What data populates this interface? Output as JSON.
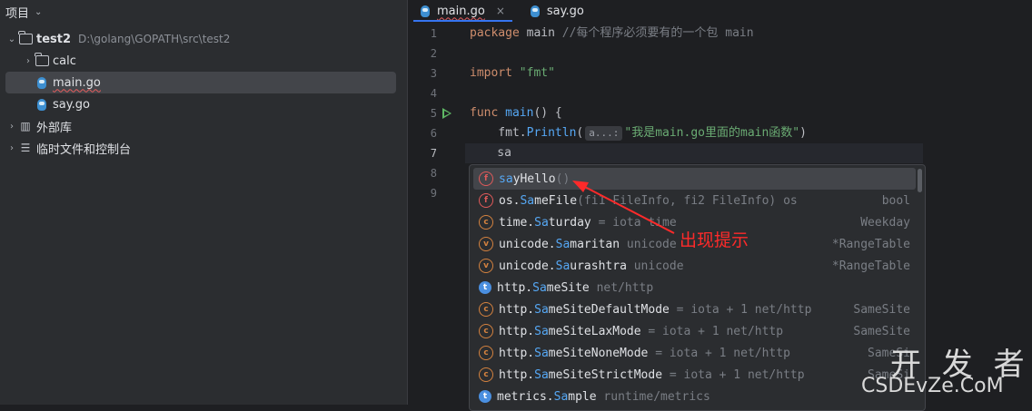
{
  "project": {
    "title": "项目",
    "items": [
      {
        "label": "test2",
        "path": "D:\\golang\\GOPATH\\src\\test2"
      },
      {
        "label": "calc"
      },
      {
        "label": "main.go"
      },
      {
        "label": "say.go"
      },
      {
        "label": "外部库"
      },
      {
        "label": "临时文件和控制台"
      }
    ]
  },
  "tabs": [
    {
      "label": "main.go",
      "close": "×"
    },
    {
      "label": "say.go"
    }
  ],
  "gutter": {
    "lines": [
      "1",
      "2",
      "3",
      "4",
      "5",
      "6",
      "7",
      "8",
      "9"
    ]
  },
  "code": {
    "l1_kw": "package",
    "l1_name": " main ",
    "l1_comment": "//每个程序必须要有的一个包 main",
    "l3_kw": "import",
    "l3_str": " \"fmt\"",
    "l5_kw": "func",
    "l5_fn": " main",
    "l5_rest": "() {",
    "l6_pkg": "    fmt.",
    "l6_fn": "Println",
    "l6_open": "(",
    "l6_hint": "a...:",
    "l6_str": "\"我是main.go里面的main函数\"",
    "l6_close": ")",
    "l7_text": "    sa"
  },
  "completion": {
    "items": [
      {
        "kind": "f",
        "match": "sa",
        "name": "yHello",
        "tail": "()",
        "type": ""
      },
      {
        "kind": "f",
        "prefix": "os.",
        "match": "Sa",
        "name": "meFile",
        "tail": "(fi1 FileInfo, fi2 FileInfo) os",
        "type": "bool"
      },
      {
        "kind": "c",
        "prefix": "time.",
        "match": "Sa",
        "name": "turday",
        "tail": " = iota time",
        "type": "Weekday"
      },
      {
        "kind": "v",
        "prefix": "unicode.",
        "match": "Sa",
        "name": "maritan",
        "tail": " unicode",
        "type": "*RangeTable"
      },
      {
        "kind": "v",
        "prefix": "unicode.",
        "match": "Sa",
        "name": "urashtra",
        "tail": " unicode",
        "type": "*RangeTable"
      },
      {
        "kind": "t",
        "prefix": "http.",
        "match": "Sa",
        "name": "meSite",
        "tail": " net/http",
        "type": ""
      },
      {
        "kind": "c",
        "prefix": "http.",
        "match": "Sa",
        "name": "meSiteDefaultMode",
        "tail": " = iota + 1 net/http",
        "type": "SameSite"
      },
      {
        "kind": "c",
        "prefix": "http.",
        "match": "Sa",
        "name": "meSiteLaxMode",
        "tail": " = iota + 1 net/http",
        "type": "SameSite"
      },
      {
        "kind": "c",
        "prefix": "http.",
        "match": "Sa",
        "name": "meSiteNoneMode",
        "tail": " = iota + 1 net/http",
        "type": "SameSi"
      },
      {
        "kind": "c",
        "prefix": "http.",
        "match": "Sa",
        "name": "meSiteStrictMode",
        "tail": " = iota + 1 net/http",
        "type": "SameSi"
      },
      {
        "kind": "t",
        "prefix": "metrics.",
        "match": "Sa",
        "name": "mple",
        "tail": " runtime/metrics",
        "type": ""
      }
    ]
  },
  "annotation": "出现提示",
  "watermark": {
    "big": "开 发 者",
    "small": "CSDEvZe.CoM"
  },
  "colors": {
    "accent": "#3574f0",
    "annotation": "#ff2a2a",
    "run": "#5fb865"
  }
}
